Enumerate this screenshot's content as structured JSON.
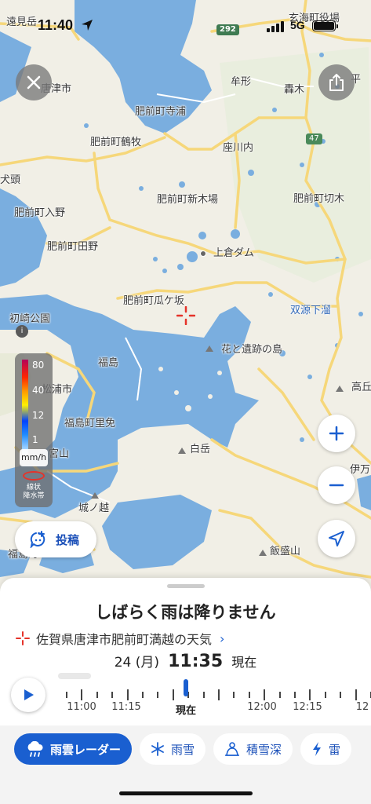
{
  "status_bar": {
    "time": "11:40",
    "network": "5G",
    "icons": [
      "location-arrow-icon",
      "signal-bars-icon",
      "battery-icon"
    ]
  },
  "map": {
    "route_shields": [
      "292",
      "47"
    ],
    "places": {
      "toomi": "遠見岳",
      "genkai": "玄海町役場",
      "karatsu": "唐津市",
      "teraura": "肥前町寺浦",
      "ushikata": "牟形",
      "todoroki": "轟木",
      "hira": "平",
      "tsurumaki": "肥前町鶴牧",
      "zagawachi": "座川内",
      "ijuumi": "犬頭",
      "shinkiba": "肥前町新木場",
      "kirigi": "肥前町切木",
      "iriya": "肥前町入野",
      "tada": "肥前町田野",
      "uekura": "上倉ダム",
      "kuregasaka": "肥前町瓜ケ坂",
      "hatsuzaki": "初崎公園",
      "sogen": "双源下溜",
      "hanaishi": "花と遺跡の島",
      "fukushima": "福島",
      "takao": "高丘",
      "matsuura": "松浦市",
      "satomen": "福島町里免",
      "miyayama": "宮山",
      "iman": "伊万",
      "shiraishi": "白岳",
      "shironokoshi": "城ノ越",
      "iinoyama": "飯盛山",
      "fukushima2": "福島町"
    }
  },
  "legend": {
    "levels": [
      "80",
      "40",
      "12",
      "1"
    ],
    "unit": "mm/h",
    "band_label_1": "線状",
    "band_label_2": "降水帯"
  },
  "post_button": {
    "label": "投稿"
  },
  "sheet": {
    "headline": "しばらく雨は降りません",
    "location": "佐賀県唐津市肥前町満越の天気",
    "date": "24 (月)",
    "time": "11:35",
    "now_label": "現在",
    "timeline_labels": [
      "11:00",
      "11:15",
      "現在",
      "12:00",
      "12:15",
      "12"
    ]
  },
  "tabs": [
    {
      "label": "雨雲レーダー",
      "icon": "rain-cloud-icon",
      "active": true
    },
    {
      "label": "雨雪",
      "icon": "snowflake-icon",
      "active": false
    },
    {
      "label": "積雪深",
      "icon": "snow-depth-icon",
      "active": false
    },
    {
      "label": "雷",
      "icon": "lightning-icon",
      "active": false
    }
  ],
  "colors": {
    "accent": "#1a5fd0",
    "water": "#7aaedf",
    "land": "#f1efe6",
    "road": "#f6d77a"
  }
}
